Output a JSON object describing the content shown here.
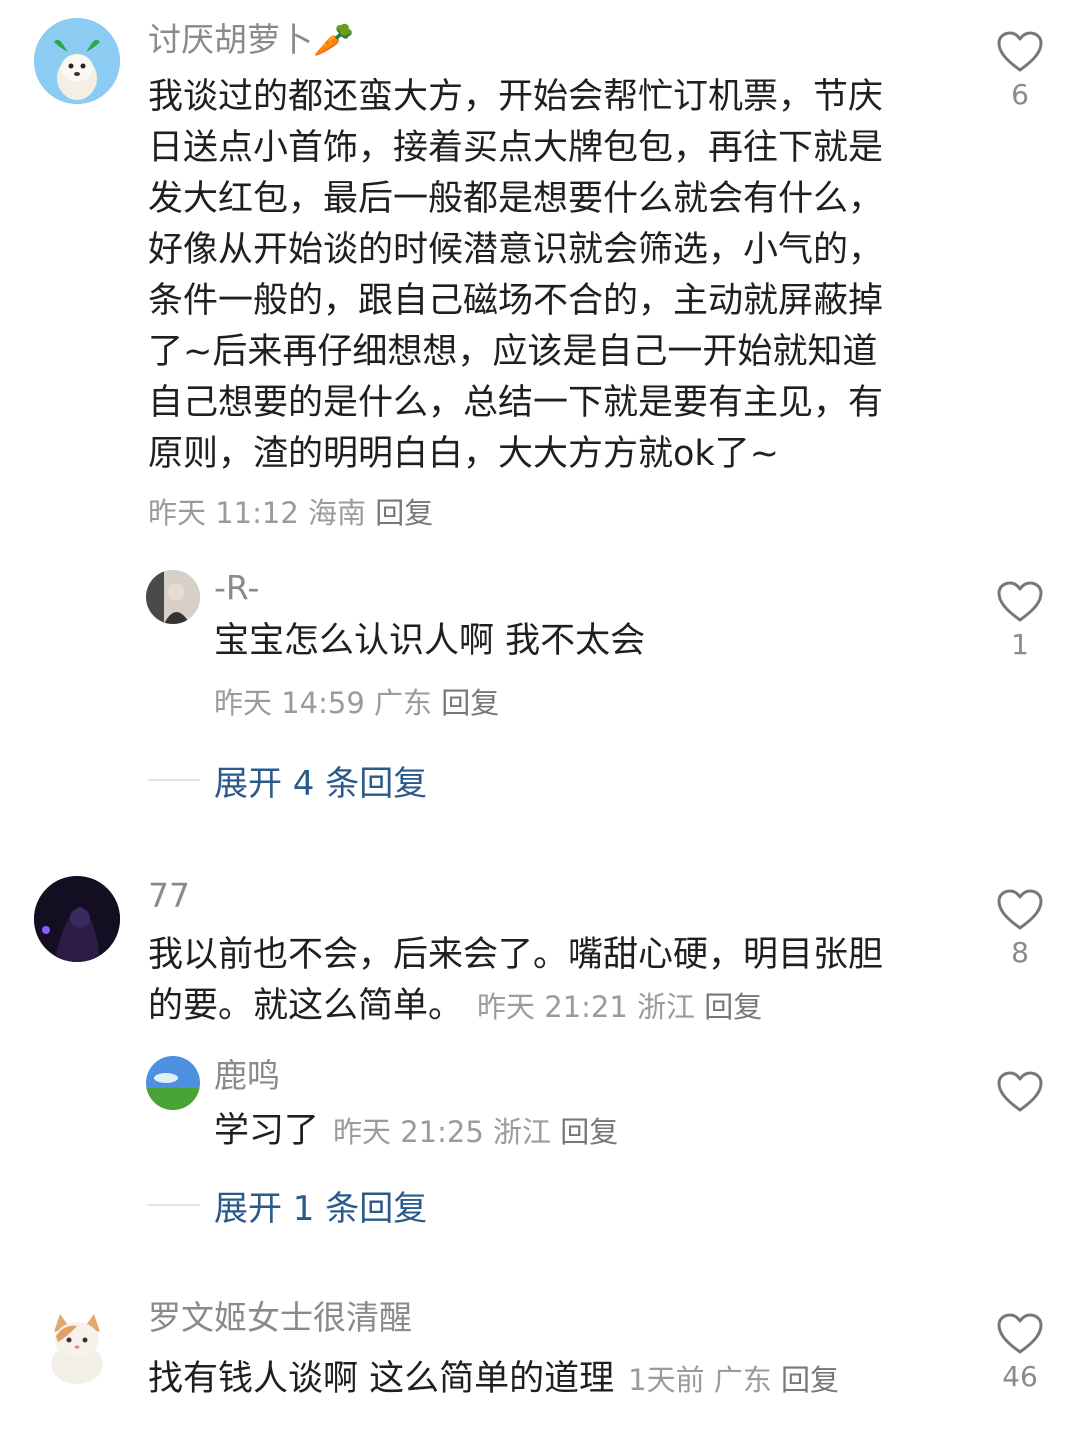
{
  "colors": {
    "name": "#8a8a8a",
    "meta": "#9b9b9b",
    "expand_link": "#2b5a8a",
    "text": "#1f1f1f"
  },
  "comments": [
    {
      "username": "讨厌胡萝卜🥕",
      "text_lines": [
        "我谈过的都还蛮大方，开始会帮忙订机票，节庆",
        "日送点小首饰，接着买点大牌包包，再往下就是",
        "发大红包，最后一般都是想要什么就会有什么，",
        "好像从开始谈的时候潜意识就会筛选，小气的，",
        "条件一般的，跟自己磁场不合的，主动就屏蔽掉",
        "了~后来再仔细想想，应该是自己一开始就知道",
        "自己想要的是什么，总结一下就是要有主见，有",
        "原则，渣的明明白白，大大方方就ok了~"
      ],
      "meta": "昨天 11:12 海南",
      "reply": "回复",
      "likes": "6",
      "replies": [
        {
          "username": "-R-",
          "text": "宝宝怎么认识人啊 我不太会",
          "meta": "昨天 14:59 广东",
          "reply": "回复",
          "likes": "1"
        }
      ],
      "expand": "展开 4 条回复"
    },
    {
      "username": "77",
      "text_lines": [
        "我以前也不会，后来会了。嘴甜心硬，明目张胆",
        "的要。就这么简单。"
      ],
      "meta": "昨天 21:21 浙江",
      "reply": "回复",
      "likes": "8",
      "replies": [
        {
          "username": "鹿鸣",
          "text": "学习了",
          "meta": "昨天 21:25 浙江",
          "reply": "回复",
          "likes": ""
        }
      ],
      "expand": "展开 1 条回复"
    },
    {
      "username": "罗文姬女士很清醒",
      "text_lines": [
        "找有钱人谈啊 这么简单的道理"
      ],
      "meta": "1天前 广东",
      "reply": "回复",
      "likes": "46"
    }
  ]
}
